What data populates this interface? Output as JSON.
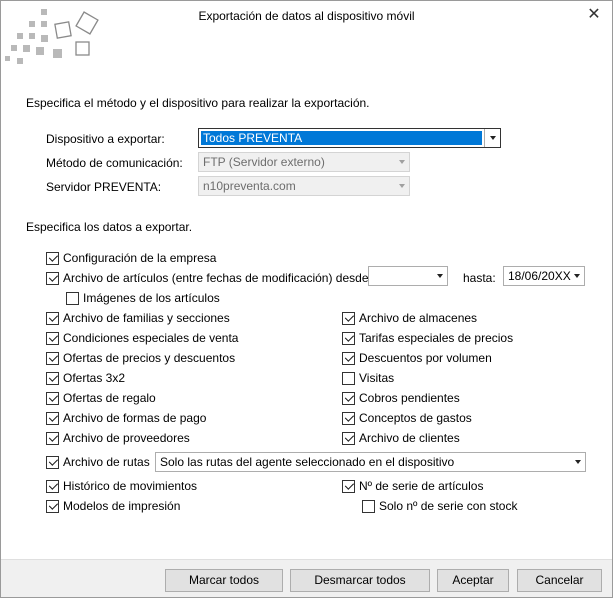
{
  "window": {
    "title": "Exportación de datos al dispositivo móvil"
  },
  "section1": {
    "heading": "Especifica el método y el dispositivo para realizar la exportación.",
    "device_label": "Dispositivo a exportar:",
    "device_value": "Todos PREVENTA",
    "method_label": "Método de comunicación:",
    "method_value": "FTP (Servidor externo)",
    "server_label": "Servidor PREVENTA:",
    "server_value": "n10preventa.com"
  },
  "section2": {
    "heading": "Especifica los datos a exportar.",
    "config": {
      "label": "Configuración de la empresa",
      "checked": true
    },
    "articles": {
      "label": "Archivo de artículos (entre fechas de modificación) desde:",
      "checked": true,
      "from_value": "",
      "to_label": "hasta:",
      "to_value": "18/06/20XX"
    },
    "article_images": {
      "label": "Imágenes de los artículos",
      "checked": false
    },
    "left": [
      {
        "label": "Archivo de familias y secciones",
        "checked": true
      },
      {
        "label": "Condiciones especiales de venta",
        "checked": true
      },
      {
        "label": "Ofertas de precios y descuentos",
        "checked": true
      },
      {
        "label": "Ofertas 3x2",
        "checked": true
      },
      {
        "label": "Ofertas de regalo",
        "checked": true
      },
      {
        "label": "Archivo de formas de pago",
        "checked": true
      },
      {
        "label": "Archivo de proveedores",
        "checked": true
      }
    ],
    "right": [
      {
        "label": "Archivo de almacenes",
        "checked": true
      },
      {
        "label": "Tarifas especiales de precios",
        "checked": true
      },
      {
        "label": "Descuentos por volumen",
        "checked": true
      },
      {
        "label": "Visitas",
        "checked": false
      },
      {
        "label": "Cobros pendientes",
        "checked": true
      },
      {
        "label": "Conceptos de gastos",
        "checked": true
      },
      {
        "label": "Archivo de clientes",
        "checked": true
      }
    ],
    "routes": {
      "label": "Archivo de rutas",
      "checked": true,
      "option": "Solo las rutas del agente seleccionado en el dispositivo"
    },
    "history": {
      "label": "Histórico de movimientos",
      "checked": true
    },
    "serial": {
      "label": "Nº de serie de artículos",
      "checked": true
    },
    "print_models": {
      "label": "Modelos de impresión",
      "checked": true
    },
    "serial_stock": {
      "label": "Solo nº de serie con stock",
      "checked": false
    }
  },
  "footer": {
    "mark_all": "Marcar todos",
    "unmark_all": "Desmarcar todos",
    "accept": "Aceptar",
    "cancel": "Cancelar"
  },
  "icons": {
    "close": "close-icon",
    "logo": "app-logo-icon"
  }
}
